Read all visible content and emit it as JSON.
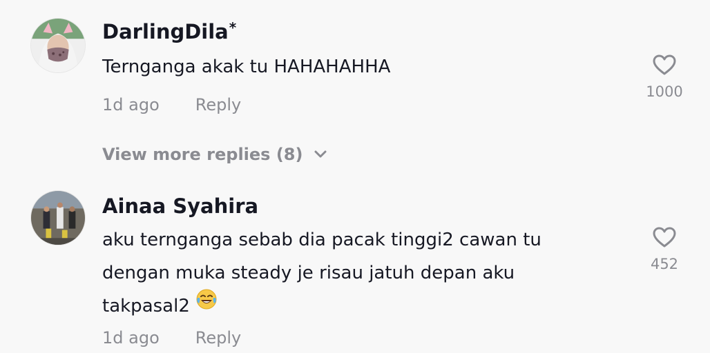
{
  "comments": [
    {
      "username": "DarlingDila",
      "username_suffix": "*",
      "text": "Terngangaakak tu HAHAHAHHA",
      "text_display": "Terngangaakak tu HAHAHAHHA",
      "time": "1d ago",
      "reply_label": "Reply",
      "likes": "1000",
      "avatar_icon": "avatar-photo-icon"
    },
    {
      "username": "Ainaa Syahira",
      "text_lines": [
        "aku ternganga sebab dia pacak tinggi2 cawan tu",
        "dengan muka steady je risau jatuh depan aku",
        "takpasal2"
      ],
      "time": "1d ago",
      "reply_label": "Reply",
      "likes": "452",
      "avatar_icon": "avatar-photo-icon"
    }
  ],
  "view_more_replies": "View more replies (8)",
  "colors": {
    "background": "#f8f8f8",
    "primary_text": "#161823",
    "secondary_text": "#8a8b91"
  }
}
